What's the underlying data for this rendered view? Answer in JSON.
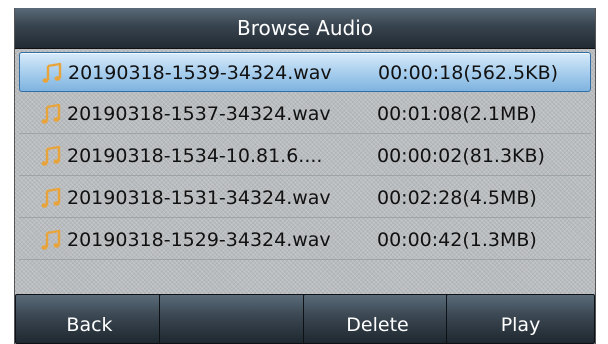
{
  "title": "Browse Audio",
  "files": [
    {
      "name": "20190318-1539-34324.wav",
      "meta": "00:00:18(562.5KB)",
      "selected": true
    },
    {
      "name": "20190318-1537-34324.wav",
      "meta": "00:01:08(2.1MB)",
      "selected": false
    },
    {
      "name": "20190318-1534-10.81.6....",
      "meta": "00:00:02(81.3KB)",
      "selected": false
    },
    {
      "name": "20190318-1531-34324.wav",
      "meta": "00:02:28(4.5MB)",
      "selected": false
    },
    {
      "name": "20190318-1529-34324.wav",
      "meta": "00:00:42(1.3MB)",
      "selected": false
    }
  ],
  "softkeys": {
    "back": "Back",
    "empty": "",
    "delete": "Delete",
    "play": "Play"
  },
  "icons": {
    "file": "music-note-icon"
  },
  "colors": {
    "note": "#e8a43a",
    "selected": "#a9cfee"
  }
}
